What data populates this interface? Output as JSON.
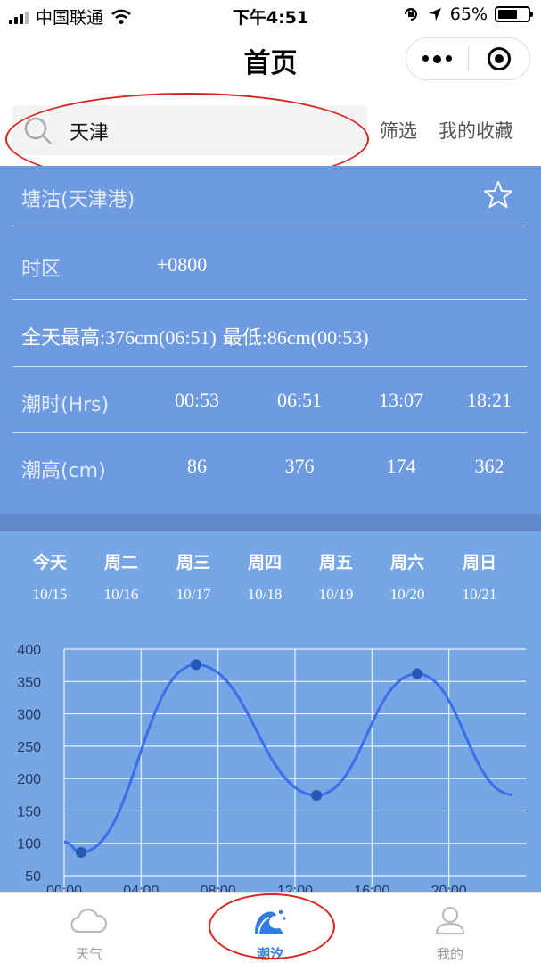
{
  "status_bar": {
    "carrier": "中国联通",
    "time": "下午4:51",
    "battery": "65%",
    "battery_level": 0.65
  },
  "nav": {
    "title": "首页"
  },
  "search": {
    "value": "天津",
    "filter_label": "筛选",
    "favorites_label": "我的收藏"
  },
  "station": {
    "name": "塘沽(天津港)",
    "timezone_label": "时区",
    "timezone_value": "+0800",
    "summary_high_label": "全天最高",
    "summary_high": ":376cm(06:51)",
    "summary_low_label": "最低",
    "summary_low": ":86cm(00:53)",
    "times_label": "潮时(Hrs)",
    "times": [
      "00:53",
      "06:51",
      "13:07",
      "18:21"
    ],
    "heights_label": "潮高(cm)",
    "heights": [
      "86",
      "376",
      "174",
      "362"
    ]
  },
  "days": [
    {
      "name": "今天",
      "date": "10/15"
    },
    {
      "name": "周二",
      "date": "10/16"
    },
    {
      "name": "周三",
      "date": "10/17"
    },
    {
      "name": "周四",
      "date": "10/18"
    },
    {
      "name": "周五",
      "date": "10/19"
    },
    {
      "name": "周六",
      "date": "10/20"
    },
    {
      "name": "周日",
      "date": "10/21"
    }
  ],
  "chart_data": {
    "type": "line",
    "x_unit": "hours",
    "ylim": [
      50,
      400
    ],
    "yticks": [
      50,
      100,
      150,
      200,
      250,
      300,
      350,
      400
    ],
    "xticks": [
      {
        "h": 0,
        "label": "00:00"
      },
      {
        "h": 4,
        "label": "04:00"
      },
      {
        "h": 8,
        "label": "08:00"
      },
      {
        "h": 12,
        "label": "12:00"
      },
      {
        "h": 16,
        "label": "16:00"
      },
      {
        "h": 20,
        "label": "20:00"
      }
    ],
    "line_color": "#3a6fe8",
    "marker_color": "#2559b8",
    "points": [
      {
        "h": 0.0,
        "v": 102
      },
      {
        "h": 0.88,
        "v": 86
      },
      {
        "h": 6.85,
        "v": 376
      },
      {
        "h": 13.12,
        "v": 174
      },
      {
        "h": 18.35,
        "v": 362
      },
      {
        "h": 23.3,
        "v": 175
      }
    ],
    "extrema": [
      {
        "h": 0.88,
        "v": 86
      },
      {
        "h": 6.85,
        "v": 376
      },
      {
        "h": 13.12,
        "v": 174
      },
      {
        "h": 18.35,
        "v": 362
      }
    ]
  },
  "tabs": [
    {
      "label": "天气",
      "icon": "cloud-icon",
      "active": false
    },
    {
      "label": "潮汐",
      "icon": "wave-icon",
      "active": true
    },
    {
      "label": "我的",
      "icon": "user-icon",
      "active": false
    }
  ]
}
